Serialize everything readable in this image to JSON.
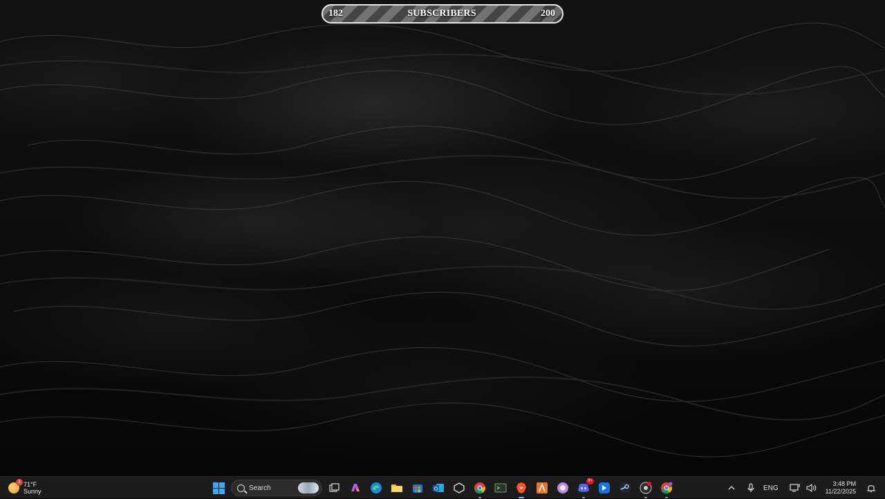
{
  "goal_bar": {
    "current": "182",
    "label": "SUBSCRIBERS",
    "target": "200",
    "progress": 0.91
  },
  "taskbar": {
    "weather": {
      "temp": "71°F",
      "condition": "Sunny",
      "badge": "1"
    },
    "search_label": "Search",
    "apps": [
      {
        "name": "start-button",
        "icon": "windows-icon"
      },
      {
        "name": "task-view-button",
        "icon": "task-view-icon"
      },
      {
        "name": "copilot-button",
        "icon": "copilot-icon"
      },
      {
        "name": "edge-button",
        "icon": "edge-icon"
      },
      {
        "name": "file-explorer-button",
        "icon": "folder-icon"
      },
      {
        "name": "store-button",
        "icon": "store-icon"
      },
      {
        "name": "outlook-button",
        "icon": "outlook-icon"
      },
      {
        "name": "app-button",
        "icon": "cube-icon"
      },
      {
        "name": "chrome-button",
        "icon": "chrome-icon"
      },
      {
        "name": "terminal-button",
        "icon": "terminal-icon"
      },
      {
        "name": "brave-button",
        "icon": "brave-icon"
      },
      {
        "name": "app-orange-button",
        "icon": "a-icon"
      },
      {
        "name": "app-round-button",
        "icon": "circle-icon"
      },
      {
        "name": "discord-button",
        "icon": "discord-icon",
        "badge": "9+"
      },
      {
        "name": "app-blue-button",
        "icon": "app-icon"
      },
      {
        "name": "steam-button",
        "icon": "steam-icon"
      },
      {
        "name": "obs-button",
        "icon": "record-icon"
      },
      {
        "name": "chrome-profile-button",
        "icon": "chrome-icon"
      }
    ],
    "tray": {
      "language": "ENG",
      "time": "3:48 PM",
      "date": "11/22/2025"
    }
  }
}
